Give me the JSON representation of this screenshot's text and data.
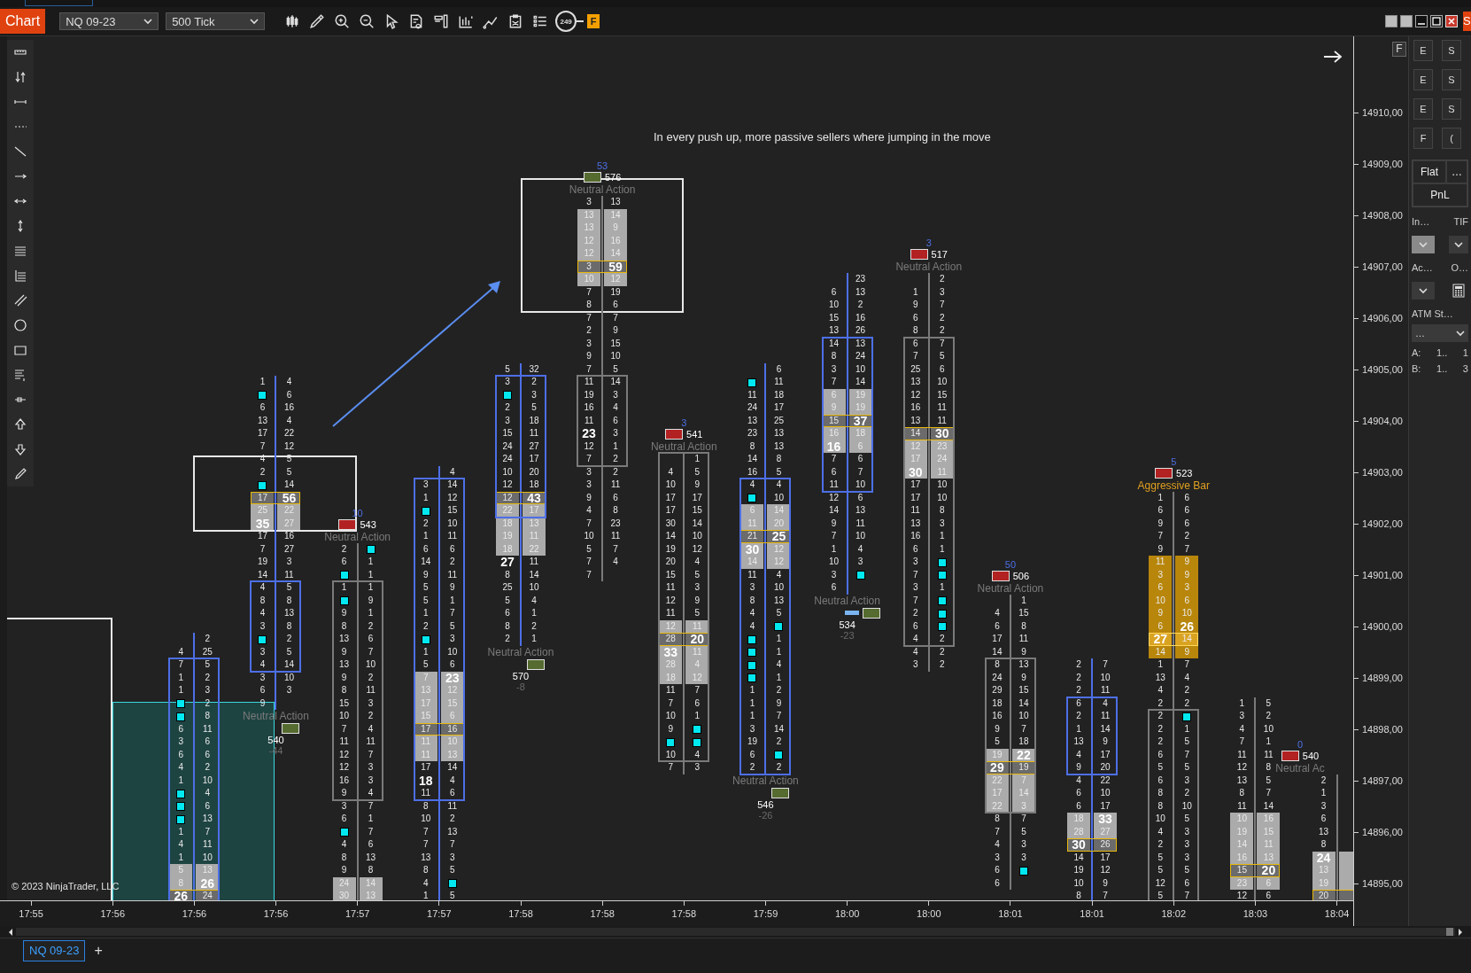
{
  "toolbar": {
    "title": "Chart",
    "instrument": "NQ 09-23",
    "interval": "500 Tick",
    "counter": "249",
    "flag": "F"
  },
  "edge_tab": "S",
  "chart": {
    "note": "In every push up, more passive sellers where jumping in the move",
    "copyright": "© 2023 NinjaTrader, LLC",
    "axis_flag": "F",
    "price_axis": [
      "14910,00",
      "14909,00",
      "14908,00",
      "14907,00",
      "14906,00",
      "14905,00",
      "14904,00",
      "14903,00",
      "14902,00",
      "14901,00",
      "14900,00",
      "14899,00",
      "14898,00",
      "14897,00",
      "14896,00",
      "14895,00"
    ],
    "time_axis": [
      "17:55",
      "17:56",
      "17:56",
      "17:56",
      "17:57",
      "17:57",
      "17:58",
      "17:58",
      "17:58",
      "17:59",
      "18:00",
      "18:00",
      "18:01",
      "18:01",
      "18:02",
      "18:03",
      "18:04"
    ],
    "bars": [
      {
        "bullish": true,
        "upper_wick": [
          {
            "ask": "2"
          },
          {
            "bid": "4",
            "ask": "25"
          }
        ],
        "body": [
          {
            "bid": "7",
            "ask": "5"
          },
          {
            "bid": "1",
            "ask": "2"
          },
          {
            "bid": "1",
            "ask": "3"
          },
          {
            "bid_dot": true,
            "ask": "2"
          },
          {
            "bid_dot": true,
            "ask": "8"
          },
          {
            "bid": "6",
            "ask": "11"
          },
          {
            "bid": "3",
            "ask": "6"
          },
          {
            "bid": "6",
            "ask": "6"
          },
          {
            "bid": "4",
            "ask": "2"
          },
          {
            "bid": "1",
            "ask": "10"
          },
          {
            "bid_dot": true,
            "ask": "4"
          },
          {
            "bid_dot": true,
            "ask": "6"
          },
          {
            "bid_dot": true,
            "ask": "13"
          },
          {
            "bid": "1",
            "ask": "7"
          },
          {
            "bid": "4",
            "ask": "11"
          },
          {
            "bid": "1",
            "ask": "10"
          },
          {
            "bid": "5",
            "ask": "13",
            "shaded": true
          },
          {
            "bid": "8",
            "ask": "26",
            "shaded": true,
            "bold_ask": true
          },
          {
            "bid": "26",
            "ask": "24",
            "poc": true,
            "bold_bid": true
          }
        ]
      },
      {
        "bullish": true,
        "signal": {
          "below": true,
          "label": "Neutral Action",
          "aggressive": false,
          "buy": true,
          "volume": "540",
          "delta": "-44"
        },
        "upper_wick": [
          {
            "bid": "1",
            "ask": "4"
          },
          {
            "bid_dot": true,
            "ask": "6"
          },
          {
            "bid": "6",
            "ask": "16"
          },
          {
            "bid": "13",
            "ask": "4"
          },
          {
            "bid": "17",
            "ask": "22"
          },
          {
            "bid": "7",
            "ask": "12"
          },
          {
            "bid": "4",
            "ask": "5"
          },
          {
            "bid": "2",
            "ask": "5"
          },
          {
            "bid_dot": true,
            "ask": "14"
          },
          {
            "bid": "17",
            "ask": "56",
            "poc": true,
            "bold_ask": true
          },
          {
            "bid": "25",
            "ask": "22",
            "shaded": true
          },
          {
            "bid": "35",
            "ask": "27",
            "shaded": true,
            "bold_bid": true
          },
          {
            "bid": "17",
            "ask": "16"
          },
          {
            "bid": "7",
            "ask": "27"
          },
          {
            "bid": "19",
            "ask": "3"
          },
          {
            "bid": "14",
            "ask": "11"
          }
        ],
        "body": [
          {
            "bid": "4",
            "ask": "5"
          },
          {
            "bid": "8",
            "ask": "8"
          },
          {
            "bid": "4",
            "ask": "13"
          },
          {
            "bid": "3",
            "ask": "8"
          },
          {
            "bid_dot": true,
            "ask": "2"
          },
          {
            "bid": "3",
            "ask": "5"
          },
          {
            "bid": "4",
            "ask": "14"
          }
        ],
        "lower_wick": [
          {
            "bid": "3",
            "ask": "10"
          },
          {
            "bid": "6",
            "ask": "3"
          },
          {
            "bid": "9"
          }
        ]
      },
      {
        "bullish": false,
        "signal": {
          "below": false,
          "count": "10",
          "volume": "543",
          "buy": false,
          "label": "Neutral Action",
          "aggressive": false
        },
        "upper_wick": [
          {
            "bid": "2",
            "ask_dot": true
          },
          {
            "bid": "6",
            "ask": "1"
          },
          {
            "bid_dot": true,
            "ask": "1"
          }
        ],
        "body": [
          {
            "bid": "1",
            "ask": "1"
          },
          {
            "bid_dot": true,
            "ask": "9"
          },
          {
            "bid": "9",
            "ask": "1"
          },
          {
            "bid": "8",
            "ask": "2"
          },
          {
            "bid": "13",
            "ask": "6"
          },
          {
            "bid": "9",
            "ask": "7"
          },
          {
            "bid": "13",
            "ask": "10"
          },
          {
            "bid": "9",
            "ask": "2"
          },
          {
            "bid": "8",
            "ask": "11"
          },
          {
            "bid": "15",
            "ask": "3"
          },
          {
            "bid": "10",
            "ask": "2"
          },
          {
            "bid": "7",
            "ask": "4"
          },
          {
            "bid": "11",
            "ask": "11"
          },
          {
            "bid": "12",
            "ask": "7"
          },
          {
            "bid": "12",
            "ask": "3"
          },
          {
            "bid": "16",
            "ask": "3"
          },
          {
            "bid": "9",
            "ask": "4"
          }
        ],
        "lower_wick": [
          {
            "bid": "3",
            "ask": "7"
          },
          {
            "bid": "6",
            "ask": "1"
          },
          {
            "bid_dot": true,
            "ask": "7"
          },
          {
            "bid": "4",
            "ask": "6"
          },
          {
            "bid": "8",
            "ask": "13"
          },
          {
            "bid": "9",
            "ask": "8"
          },
          {
            "bid": "24",
            "ask": "14",
            "shaded": true
          },
          {
            "bid": "30",
            "ask": "13",
            "shaded": true
          }
        ]
      },
      {
        "bullish": true,
        "upper_wick": [
          {
            "ask": "4"
          }
        ],
        "body": [
          {
            "bid": "3",
            "ask": "14"
          },
          {
            "bid": "1",
            "ask": "12"
          },
          {
            "bid_dot": true,
            "ask": "15"
          },
          {
            "bid": "2",
            "ask": "10"
          },
          {
            "bid": "1",
            "ask": "11"
          },
          {
            "bid": "6",
            "ask": "6"
          },
          {
            "bid": "14",
            "ask": "2"
          },
          {
            "bid": "9",
            "ask": "11"
          },
          {
            "bid": "5",
            "ask": "9"
          },
          {
            "bid": "5",
            "ask": "1"
          },
          {
            "bid": "1",
            "ask": "7"
          },
          {
            "bid": "2",
            "ask": "5"
          },
          {
            "bid_dot": true,
            "ask": "3"
          },
          {
            "bid": "1",
            "ask": "10"
          },
          {
            "bid": "5",
            "ask": "6"
          },
          {
            "bid": "7",
            "ask": "23",
            "shaded": true,
            "bold_ask": true
          },
          {
            "bid": "13",
            "ask": "12",
            "shaded": true
          },
          {
            "bid": "17",
            "ask": "15",
            "shaded": true
          },
          {
            "bid": "15",
            "ask": "6",
            "shaded": true
          },
          {
            "bid": "17",
            "ask": "16",
            "poc": true
          },
          {
            "bid": "11",
            "ask": "10",
            "shaded": true
          },
          {
            "bid": "11",
            "ask": "13",
            "shaded": true
          },
          {
            "bid": "17",
            "ask": "14"
          },
          {
            "bid": "18",
            "ask": "4",
            "bold_bid": true
          },
          {
            "bid": "11",
            "ask": "6"
          }
        ],
        "lower_wick": [
          {
            "bid": "8",
            "ask": "11"
          },
          {
            "bid": "10",
            "ask": "2"
          },
          {
            "bid": "7",
            "ask": "13"
          },
          {
            "bid": "7",
            "ask": "7"
          },
          {
            "bid": "13",
            "ask": "3"
          },
          {
            "bid": "8",
            "ask": "5"
          },
          {
            "bid": "4",
            "ask_dot": true
          },
          {
            "bid": "1",
            "ask": "5"
          }
        ]
      },
      {
        "bullish": true,
        "signal": {
          "below": true,
          "label": "Neutral Action",
          "aggressive": false,
          "buy": true,
          "volume": "570",
          "delta": "-8"
        },
        "upper_wick": [
          {
            "bid": "5",
            "ask": "32"
          }
        ],
        "body": [
          {
            "bid": "3",
            "ask": "2"
          },
          {
            "bid_dot": true,
            "ask": "3"
          },
          {
            "bid": "2",
            "ask": "5"
          },
          {
            "bid": "3",
            "ask": "18"
          },
          {
            "bid": "15",
            "ask": "11"
          },
          {
            "bid": "24",
            "ask": "27"
          },
          {
            "bid": "24",
            "ask": "17"
          },
          {
            "bid": "10",
            "ask": "20"
          },
          {
            "bid": "12",
            "ask": "18"
          },
          {
            "bid": "12",
            "ask": "43",
            "poc": true,
            "bold_ask": true
          },
          {
            "bid": "22",
            "ask": "17",
            "shaded": true
          }
        ],
        "lower_wick": [
          {
            "bid": "18",
            "ask": "13",
            "shaded": true
          },
          {
            "bid": "19",
            "ask": "11",
            "shaded": true
          },
          {
            "bid": "18",
            "ask": "22",
            "shaded": true
          },
          {
            "bid": "27",
            "ask": "11",
            "bold_bid": true
          },
          {
            "bid": "8",
            "ask": "14"
          },
          {
            "bid": "25",
            "ask": "10"
          },
          {
            "bid": "5",
            "ask": "4"
          },
          {
            "bid": "6",
            "ask": "1"
          },
          {
            "bid": "8",
            "ask": "2"
          },
          {
            "bid": "2",
            "ask": "1"
          }
        ]
      },
      {
        "bullish": false,
        "signal": {
          "below": false,
          "count": "53",
          "volume": "576",
          "buy": true,
          "label": "Neutral Action",
          "aggressive": false
        },
        "upper_wick": [
          {
            "bid": "3",
            "ask": "13"
          },
          {
            "bid": "13",
            "ask": "14",
            "shaded": true
          },
          {
            "bid": "13",
            "ask": "9",
            "shaded": true
          },
          {
            "bid": "12",
            "ask": "16",
            "shaded": true
          },
          {
            "bid": "12",
            "ask": "14",
            "shaded": true
          },
          {
            "bid": "3",
            "ask": "59",
            "poc": true,
            "bold_ask": true
          },
          {
            "bid": "10",
            "ask": "12",
            "shaded": true
          },
          {
            "bid": "7",
            "ask": "19"
          },
          {
            "bid": "8",
            "ask": "6"
          },
          {
            "bid": "7",
            "ask": "7"
          },
          {
            "bid": "2",
            "ask": "9"
          },
          {
            "bid": "3",
            "ask": "15"
          },
          {
            "bid": "9",
            "ask": "10"
          },
          {
            "bid": "7",
            "ask": "5"
          }
        ],
        "body": [
          {
            "bid": "11",
            "ask": "14"
          },
          {
            "bid": "19",
            "ask": "3"
          },
          {
            "bid": "16",
            "ask": "4"
          },
          {
            "bid": "11",
            "ask": "6"
          },
          {
            "bid": "23",
            "ask": "3",
            "bold_bid": true
          },
          {
            "bid": "12",
            "ask": "1"
          },
          {
            "bid": "7",
            "ask": "2"
          }
        ],
        "lower_wick": [
          {
            "bid": "3",
            "ask": "2"
          },
          {
            "bid": "3",
            "ask": "11"
          },
          {
            "bid": "9",
            "ask": "6"
          },
          {
            "bid": "4",
            "ask": "8"
          },
          {
            "bid": "7",
            "ask": "23"
          },
          {
            "bid": "10",
            "ask": "11"
          },
          {
            "bid": "5",
            "ask": "7"
          },
          {
            "bid": "7",
            "ask": "4"
          },
          {
            "bid": "7"
          }
        ]
      },
      {
        "bullish": false,
        "signal": {
          "below": false,
          "count": "3",
          "volume": "541",
          "buy": false,
          "label": "Neutral Action",
          "aggressive": false
        },
        "body": [
          {
            "ask": "1"
          },
          {
            "bid": "4",
            "ask": "5"
          },
          {
            "bid": "10",
            "ask": "9"
          },
          {
            "bid": "17",
            "ask": "17"
          },
          {
            "bid": "17",
            "ask": "15"
          },
          {
            "bid": "30",
            "ask": "14"
          },
          {
            "bid": "14",
            "ask": "10"
          },
          {
            "bid": "19",
            "ask": "12"
          },
          {
            "bid": "20",
            "ask": "4"
          },
          {
            "bid": "15",
            "ask": "5"
          },
          {
            "bid": "11",
            "ask": "3"
          },
          {
            "bid": "12",
            "ask": "9"
          },
          {
            "bid": "11",
            "ask": "5"
          },
          {
            "bid": "12",
            "ask": "11",
            "shaded": true
          },
          {
            "bid": "28",
            "ask": "20",
            "poc": true,
            "bold_ask": true
          },
          {
            "bid": "33",
            "ask": "11",
            "shaded": true,
            "bold_bid": true
          },
          {
            "bid": "28",
            "ask": "4",
            "shaded": true
          },
          {
            "bid": "18",
            "ask": "12",
            "shaded": true
          },
          {
            "bid": "11",
            "ask": "7"
          },
          {
            "bid": "7",
            "ask": "6"
          },
          {
            "bid": "10",
            "ask": "1"
          },
          {
            "bid": "9",
            "ask_dot": true
          },
          {
            "bid_dot": true,
            "ask_dot": true
          },
          {
            "bid": "10",
            "ask": "4"
          }
        ],
        "lower_wick": [
          {
            "bid": "7",
            "ask": "3"
          }
        ]
      },
      {
        "bullish": true,
        "signal": {
          "below": true,
          "label": "Neutral Action",
          "aggressive": false,
          "buy": true,
          "volume": "546",
          "delta": "-26"
        },
        "upper_wick": [
          {
            "ask": "6"
          },
          {
            "bid_dot": true,
            "ask": "11"
          },
          {
            "bid": "11",
            "ask": "18"
          },
          {
            "bid": "24",
            "ask": "17"
          },
          {
            "bid": "13",
            "ask": "25"
          },
          {
            "bid": "23",
            "ask": "13"
          },
          {
            "bid": "8",
            "ask": "13"
          },
          {
            "bid": "14",
            "ask": "8"
          },
          {
            "bid": "16",
            "ask": "5"
          }
        ],
        "body": [
          {
            "bid": "4",
            "ask": "4"
          },
          {
            "bid_dot": true,
            "ask": "10"
          },
          {
            "bid": "6",
            "ask": "14",
            "shaded": true
          },
          {
            "bid": "11",
            "ask": "20",
            "shaded": true
          },
          {
            "bid": "21",
            "ask": "25",
            "poc": true,
            "bold_ask": true
          },
          {
            "bid": "30",
            "ask": "12",
            "shaded": true,
            "bold_bid": true
          },
          {
            "bid": "14",
            "ask": "12",
            "shaded": true
          },
          {
            "bid": "11",
            "ask": "4"
          },
          {
            "bid": "3",
            "ask": "10"
          },
          {
            "bid": "8",
            "ask": "13"
          },
          {
            "bid": "4",
            "ask": "5"
          },
          {
            "bid": "4",
            "ask_dot": true
          },
          {
            "bid_dot": true,
            "ask": "1"
          },
          {
            "bid_dot": true,
            "ask": "1"
          },
          {
            "bid_dot": true,
            "ask": "4"
          },
          {
            "bid_dot": true,
            "ask": "1"
          },
          {
            "bid": "1",
            "ask": "2"
          },
          {
            "bid": "1",
            "ask": "9"
          },
          {
            "bid": "1",
            "ask": "7"
          },
          {
            "bid": "3",
            "ask": "14"
          },
          {
            "bid": "19",
            "ask": "2"
          },
          {
            "bid": "6",
            "ask_dot": true
          },
          {
            "bid": "2",
            "ask": "2"
          }
        ]
      },
      {
        "bullish": true,
        "signal": {
          "below": true,
          "label": "Neutral Action",
          "aggressive": false,
          "buy": true,
          "volume": "534",
          "delta": "-23",
          "pending_marker": true
        },
        "upper_wick": [
          {
            "ask": "23"
          },
          {
            "bid": "6",
            "ask": "13"
          },
          {
            "bid": "10",
            "ask": "2"
          },
          {
            "bid": "15",
            "ask": "16"
          },
          {
            "bid": "13",
            "ask": "26"
          }
        ],
        "body": [
          {
            "bid": "14",
            "ask": "13"
          },
          {
            "bid": "8",
            "ask": "24"
          },
          {
            "bid": "3",
            "ask": "10"
          },
          {
            "bid": "7",
            "ask": "14"
          },
          {
            "bid": "6",
            "ask": "19",
            "shaded": true
          },
          {
            "bid": "9",
            "ask": "19",
            "shaded": true
          },
          {
            "bid": "15",
            "ask": "37",
            "poc": true,
            "bold_ask": true
          },
          {
            "bid": "16",
            "ask": "18",
            "shaded": true
          },
          {
            "bid": "16",
            "ask": "6",
            "shaded": true,
            "bold_bid": true
          },
          {
            "bid": "7",
            "ask": "6"
          },
          {
            "bid": "6",
            "ask": "7"
          },
          {
            "bid": "11",
            "ask": "10"
          }
        ],
        "lower_wick": [
          {
            "bid": "12",
            "ask": "6"
          },
          {
            "bid": "14",
            "ask": "13"
          },
          {
            "bid": "9",
            "ask": "11"
          },
          {
            "bid": "7",
            "ask": "10"
          },
          {
            "bid": "1",
            "ask": "4"
          },
          {
            "bid": "10",
            "ask": "3"
          },
          {
            "bid": "3",
            "ask_dot": true
          },
          {
            "bid": "6"
          }
        ]
      },
      {
        "bullish": false,
        "signal": {
          "below": false,
          "count": "3",
          "volume": "517",
          "buy": false,
          "label": "Neutral Action",
          "aggressive": false
        },
        "upper_wick": [
          {
            "ask": "2"
          },
          {
            "bid": "1",
            "ask": "3"
          },
          {
            "bid": "9",
            "ask": "7"
          },
          {
            "bid": "6",
            "ask": "2"
          },
          {
            "bid": "8",
            "ask": "2"
          }
        ],
        "body": [
          {
            "bid": "6",
            "ask": "7"
          },
          {
            "bid": "7",
            "ask": "5"
          },
          {
            "bid": "25",
            "ask": "6"
          },
          {
            "bid": "13",
            "ask": "10"
          },
          {
            "bid": "12",
            "ask": "15"
          },
          {
            "bid": "16",
            "ask": "11"
          },
          {
            "bid": "13",
            "ask": "11"
          },
          {
            "bid": "14",
            "ask": "30",
            "poc": true,
            "bold_ask": true
          },
          {
            "bid": "12",
            "ask": "23",
            "shaded": true
          },
          {
            "bid": "17",
            "ask": "24",
            "shaded": true
          },
          {
            "bid": "30",
            "ask": "11",
            "shaded": true,
            "bold_bid": true
          },
          {
            "bid": "17",
            "ask": "10"
          },
          {
            "bid": "17",
            "ask": "10"
          },
          {
            "bid": "11",
            "ask": "8"
          },
          {
            "bid": "13",
            "ask": "3"
          },
          {
            "bid": "16",
            "ask": "1"
          },
          {
            "bid": "6",
            "ask": "1"
          },
          {
            "bid": "3",
            "ask_dot": true
          },
          {
            "bid": "7",
            "ask_dot": true
          },
          {
            "bid": "3",
            "ask": "1"
          },
          {
            "bid": "7",
            "ask_dot": true
          },
          {
            "bid": "2",
            "ask_dot": true
          },
          {
            "bid": "6",
            "ask_dot": true
          },
          {
            "bid": "4",
            "ask": "2"
          }
        ],
        "lower_wick": [
          {
            "bid": "4",
            "ask": "2"
          },
          {
            "bid": "3",
            "ask": "2"
          }
        ]
      },
      {
        "bullish": false,
        "signal": {
          "below": false,
          "count": "50",
          "volume": "506",
          "buy": false,
          "label": "Neutral Action",
          "aggressive": false
        },
        "upper_wick": [
          {
            "ask": "1"
          },
          {
            "bid": "4",
            "ask": "15"
          },
          {
            "bid": "6",
            "ask": "8"
          },
          {
            "bid": "17",
            "ask": "11"
          },
          {
            "bid": "14",
            "ask": "9"
          }
        ],
        "body": [
          {
            "bid": "8",
            "ask": "13"
          },
          {
            "bid": "24",
            "ask": "9"
          },
          {
            "bid": "29",
            "ask": "15"
          },
          {
            "bid": "18",
            "ask": "14"
          },
          {
            "bid": "16",
            "ask": "10"
          },
          {
            "bid": "9",
            "ask": "7"
          },
          {
            "bid": "5",
            "ask": "18"
          },
          {
            "bid": "19",
            "ask": "22",
            "shaded": true,
            "bold_ask": true
          },
          {
            "bid": "29",
            "ask": "19",
            "poc": true,
            "bold_bid": true
          },
          {
            "bid": "22",
            "ask": "7",
            "shaded": true
          },
          {
            "bid": "17",
            "ask": "14",
            "shaded": true
          },
          {
            "bid": "22",
            "ask": "3",
            "shaded": true
          }
        ],
        "lower_wick": [
          {
            "bid": "8",
            "ask": "7"
          },
          {
            "bid": "7",
            "ask": "5"
          },
          {
            "bid": "4",
            "ask": "3"
          },
          {
            "bid": "3",
            "ask": "3"
          },
          {
            "bid": "6",
            "ask_dot": true
          },
          {
            "bid": "6"
          }
        ]
      },
      {
        "bullish": true,
        "upper_wick": [
          {
            "bid": "2",
            "ask": "7"
          },
          {
            "bid": "2",
            "ask": "10"
          },
          {
            "bid": "2",
            "ask": "11"
          }
        ],
        "body": [
          {
            "bid": "6",
            "ask": "4"
          },
          {
            "bid": "2",
            "ask": "11"
          },
          {
            "bid": "1",
            "ask": "14"
          },
          {
            "bid": "13",
            "ask": "9"
          },
          {
            "bid": "4",
            "ask": "17"
          },
          {
            "bid": "9",
            "ask": "20"
          }
        ],
        "lower_wick": [
          {
            "bid": "4",
            "ask": "22"
          },
          {
            "bid": "6",
            "ask": "10"
          },
          {
            "bid": "6",
            "ask": "17"
          },
          {
            "bid": "18",
            "ask": "33",
            "shaded": true,
            "bold_ask": true
          },
          {
            "bid": "28",
            "ask": "27",
            "shaded": true
          },
          {
            "bid": "30",
            "ask": "26",
            "poc": true,
            "bold_bid": true
          },
          {
            "bid": "14",
            "ask": "17"
          },
          {
            "bid": "19",
            "ask": "12"
          },
          {
            "bid": "10",
            "ask": "9"
          },
          {
            "bid": "8",
            "ask": "7"
          }
        ]
      },
      {
        "bullish": false,
        "signal": {
          "below": false,
          "count": "5",
          "volume": "523",
          "buy": false,
          "label": "Aggressive Bar",
          "aggressive": true
        },
        "upper_wick": [
          {
            "bid": "1",
            "ask": "6"
          },
          {
            "bid": "6",
            "ask": "6"
          },
          {
            "bid": "9",
            "ask": "6"
          },
          {
            "bid": "7",
            "ask": "2"
          },
          {
            "bid": "9",
            "ask": "7"
          },
          {
            "bid": "11",
            "ask": "9",
            "aggressive": true
          },
          {
            "bid": "3",
            "ask": "9",
            "aggressive": true
          },
          {
            "bid": "6",
            "ask": "3",
            "aggressive": true
          },
          {
            "bid": "10",
            "ask": "6",
            "aggressive": true
          },
          {
            "bid": "9",
            "ask": "10",
            "aggressive": true
          },
          {
            "bid": "6",
            "ask": "26",
            "aggressive": true,
            "bold_ask": true
          },
          {
            "bid": "27",
            "ask": "14",
            "aggressive": true,
            "poc": true,
            "bold_bid": true
          },
          {
            "bid": "14",
            "ask": "9",
            "aggressive": true
          },
          {
            "bid": "1",
            "ask": "7"
          },
          {
            "bid": "13",
            "ask": "4"
          },
          {
            "bid": "4",
            "ask": "2"
          },
          {
            "bid": "2",
            "ask": "2"
          }
        ],
        "body": [
          {
            "bid": "2",
            "ask_dot": true
          },
          {
            "bid": "2",
            "ask": "1"
          },
          {
            "bid": "2",
            "ask": "5"
          },
          {
            "bid": "6",
            "ask": "7"
          },
          {
            "bid": "5",
            "ask": "5"
          },
          {
            "bid": "6",
            "ask": "3"
          },
          {
            "bid": "8",
            "ask": "2"
          },
          {
            "bid": "8",
            "ask": "10"
          },
          {
            "bid": "10",
            "ask": "5"
          },
          {
            "bid": "4",
            "ask": "3"
          },
          {
            "bid": "2",
            "ask": "3"
          },
          {
            "bid": "5",
            "ask": "3"
          },
          {
            "bid": "5",
            "ask": "5"
          },
          {
            "bid": "12",
            "ask": "6"
          },
          {
            "bid": "5",
            "ask": "7"
          }
        ]
      },
      {
        "bullish": false,
        "upper_wick": [
          {
            "bid": "1",
            "ask": "5"
          },
          {
            "bid": "3",
            "ask": "2"
          },
          {
            "bid": "4",
            "ask": "10"
          },
          {
            "bid": "7",
            "ask": "1"
          },
          {
            "bid": "11",
            "ask": "11"
          },
          {
            "bid": "12",
            "ask": "8"
          },
          {
            "bid": "13",
            "ask": "5"
          },
          {
            "bid": "8",
            "ask": "7"
          },
          {
            "bid": "11",
            "ask": "14"
          },
          {
            "bid": "10",
            "ask": "16",
            "shaded": true
          },
          {
            "bid": "19",
            "ask": "15",
            "shaded": true
          },
          {
            "bid": "14",
            "ask": "11",
            "shaded": true
          },
          {
            "bid": "16",
            "ask": "13",
            "shaded": true
          },
          {
            "bid": "15",
            "ask": "20",
            "poc": true,
            "bold_ask": true
          },
          {
            "bid": "23",
            "ask": "6",
            "shaded": true
          },
          {
            "bid": "12",
            "ask": "6"
          }
        ]
      },
      {
        "bullish": false,
        "signal": {
          "below": false,
          "count": "0",
          "volume": "540",
          "buy": false,
          "label": "Neutral Ac",
          "aggressive": false
        },
        "upper_wick": [
          {
            "bid": "2"
          },
          {
            "bid": "1"
          },
          {
            "bid": "3"
          },
          {
            "bid": "6"
          },
          {
            "bid": "13"
          },
          {
            "bid": "8"
          },
          {
            "bid": "24",
            "shaded": true,
            "bold_bid": true
          },
          {
            "bid": "13",
            "shaded": true
          },
          {
            "bid": "19",
            "shaded": true
          },
          {
            "bid": "20",
            "poc": true
          }
        ]
      }
    ]
  },
  "order_panel": {
    "buttons": [
      "E",
      "S",
      "E",
      "S",
      "E",
      "S",
      "F",
      "("
    ],
    "flat": "Flat",
    "flat_menu": "…",
    "pnl": "PnL",
    "instrument_label": "In…",
    "tif_label": "TIF",
    "instrument_disabled": true,
    "account_label": "Ac…",
    "order_label": "O…",
    "atm_label": "ATM St…",
    "atm_value": "…",
    "positions": [
      {
        "label": "A:",
        "name": "1..",
        "value": "1"
      },
      {
        "label": "B:",
        "name": "1..",
        "value": "3"
      }
    ]
  },
  "tabs": [
    {
      "label": "NQ 09-23",
      "selected": true
    }
  ],
  "add_tab": "+"
}
